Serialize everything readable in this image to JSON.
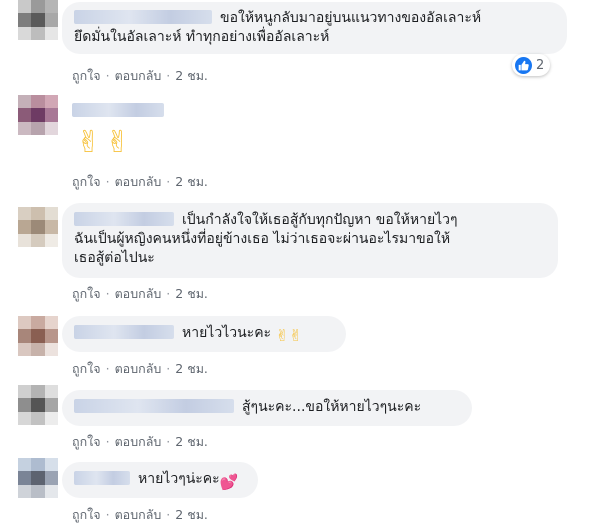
{
  "labels": {
    "like": "ถูกใจ",
    "reply": "ตอบกลับ",
    "time": "2 ชม.",
    "separator": "·"
  },
  "comments": [
    {
      "lines": [
        "ขอให้หนูกลับมาอยู่บนแนวทางของอัลเลาะห์",
        "ยึดมั่นในอัลเลาะห์ ทำทุกอย่างเพื่ออัลเลาะห์"
      ],
      "reaction_count": "2",
      "avatar_colors": [
        "#c9c9c9",
        "#9a9a9a",
        "#b5b5b5",
        "#7d7d7d",
        "#5a5a5a",
        "#a8a8a8",
        "#d9d9d9",
        "#bdbdbd",
        "#e6e6e6"
      ]
    },
    {
      "emoji": "✌✌",
      "avatar_colors": [
        "#c4b0b8",
        "#b98e9e",
        "#d1a7b5",
        "#8b5b78",
        "#6e3b64",
        "#a87896",
        "#cbb9c1",
        "#b7a3ad",
        "#e2d6dc"
      ]
    },
    {
      "lines": [
        "เป็นกำลังใจให้เธอสู้กับทุกปัญหา ขอให้หายไวๆ",
        "ฉันเป็นผู้หญิงคนหนึ่งที่อยู่ข้างเธอ ไม่ว่าเธอจะผ่านอะไรมาขอให้",
        "เธอสู้ต่อไปนะ"
      ],
      "avatar_colors": [
        "#d9cfc2",
        "#cdbfae",
        "#e3ddd3",
        "#b9a793",
        "#9c8a78",
        "#c8b8a6",
        "#e8e2da",
        "#d5cbbe",
        "#efebe5"
      ]
    },
    {
      "lines": [
        "หายไวไวนะคะ"
      ],
      "emoji": "✌✌",
      "avatar_colors": [
        "#ddc9c1",
        "#c9aaa0",
        "#e6d4cd",
        "#a8867a",
        "#8a5f52",
        "#b8968b",
        "#d9c7c0",
        "#c7b2aa",
        "#ece2de"
      ]
    },
    {
      "lines": [
        "สู้ๆนะคะ...ขอให้หายไวๆนะคะ"
      ],
      "avatar_colors": [
        "#cfcfcf",
        "#b3b3b3",
        "#dedede",
        "#8e8e8e",
        "#555555",
        "#a5a5a5",
        "#d7d7d7",
        "#c2c2c2",
        "#ececec"
      ]
    },
    {
      "lines": [
        "หายไวๆน่ะคะ"
      ],
      "emoji": "💕",
      "avatar_colors": [
        "#c5d1e0",
        "#aebcd0",
        "#d6dfea",
        "#7a8496",
        "#5d6370",
        "#9aa3b3",
        "#cfd3d9",
        "#b9bec7",
        "#e4e7eb"
      ]
    }
  ],
  "colors": {
    "bubble_bg": "#f2f3f5",
    "action_text": "#606770",
    "like_blue": "#1877f2",
    "heart_pink": "#e8457c",
    "emoji_yellow": "#f7c23b"
  }
}
